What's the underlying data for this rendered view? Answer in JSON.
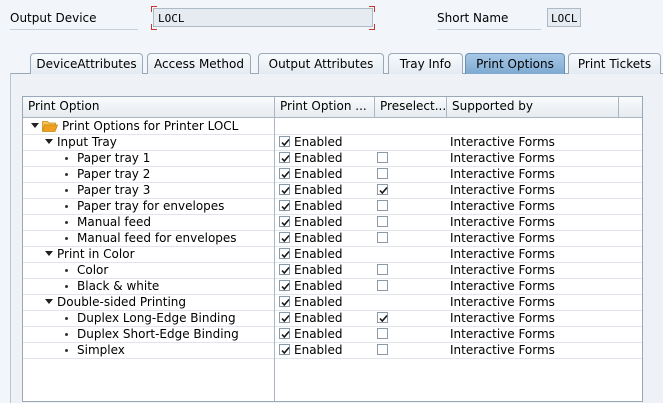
{
  "header": {
    "output_device_label": "Output Device",
    "output_device_value": "LOCL",
    "short_name_label": "Short Name",
    "short_name_value": "LOCL"
  },
  "tabs": [
    {
      "label": "DeviceAttributes"
    },
    {
      "label": "Access Method"
    },
    {
      "label": "Output Attributes"
    },
    {
      "label": "Tray Info"
    },
    {
      "label": "Print Options",
      "active": true
    },
    {
      "label": "Print Tickets"
    }
  ],
  "table": {
    "columns": [
      "Print Option",
      "Print Option ...",
      "Preselect...",
      "Supported by"
    ],
    "rows": [
      {
        "label": "Print Options for Printer LOCL",
        "level": 0,
        "node": "folder",
        "option": "",
        "enabled": null,
        "preselect": null,
        "supported": ""
      },
      {
        "label": "Input Tray",
        "level": 1,
        "node": "expanded",
        "option": "Enabled",
        "enabled": true,
        "preselect": null,
        "supported": "Interactive Forms"
      },
      {
        "label": "Paper tray 1",
        "level": 2,
        "node": "leaf",
        "option": "Enabled",
        "enabled": true,
        "preselect": false,
        "supported": "Interactive Forms"
      },
      {
        "label": "Paper tray 2",
        "level": 2,
        "node": "leaf",
        "option": "Enabled",
        "enabled": true,
        "preselect": false,
        "supported": "Interactive Forms"
      },
      {
        "label": "Paper tray 3",
        "level": 2,
        "node": "leaf",
        "option": "Enabled",
        "enabled": true,
        "preselect": true,
        "supported": "Interactive Forms"
      },
      {
        "label": "Paper tray for envelopes",
        "level": 2,
        "node": "leaf",
        "option": "Enabled",
        "enabled": true,
        "preselect": false,
        "supported": "Interactive Forms"
      },
      {
        "label": "Manual feed",
        "level": 2,
        "node": "leaf",
        "option": "Enabled",
        "enabled": true,
        "preselect": false,
        "supported": "Interactive Forms"
      },
      {
        "label": "Manual feed for envelopes",
        "level": 2,
        "node": "leaf",
        "option": "Enabled",
        "enabled": true,
        "preselect": false,
        "supported": "Interactive Forms"
      },
      {
        "label": "Print in Color",
        "level": 1,
        "node": "expanded",
        "option": "Enabled",
        "enabled": true,
        "preselect": null,
        "supported": "Interactive Forms"
      },
      {
        "label": "Color",
        "level": 2,
        "node": "leaf",
        "option": "Enabled",
        "enabled": true,
        "preselect": false,
        "supported": "Interactive Forms"
      },
      {
        "label": "Black & white",
        "level": 2,
        "node": "leaf",
        "option": "Enabled",
        "enabled": true,
        "preselect": false,
        "supported": "Interactive Forms"
      },
      {
        "label": "Double-sided Printing",
        "level": 1,
        "node": "expanded",
        "option": "Enabled",
        "enabled": true,
        "preselect": null,
        "supported": "Interactive Forms"
      },
      {
        "label": "Duplex Long-Edge Binding",
        "level": 2,
        "node": "leaf",
        "option": "Enabled",
        "enabled": true,
        "preselect": true,
        "supported": "Interactive Forms"
      },
      {
        "label": "Duplex Short-Edge Binding",
        "level": 2,
        "node": "leaf",
        "option": "Enabled",
        "enabled": true,
        "preselect": false,
        "supported": "Interactive Forms"
      },
      {
        "label": "Simplex",
        "level": 2,
        "node": "leaf",
        "option": "Enabled",
        "enabled": true,
        "preselect": false,
        "supported": "Interactive Forms"
      }
    ]
  },
  "colors": {
    "active_tab": "#8fb6dc",
    "folder": "#f0a020",
    "required_marker": "#c0392b",
    "header_bg": "#f2f6fa"
  }
}
